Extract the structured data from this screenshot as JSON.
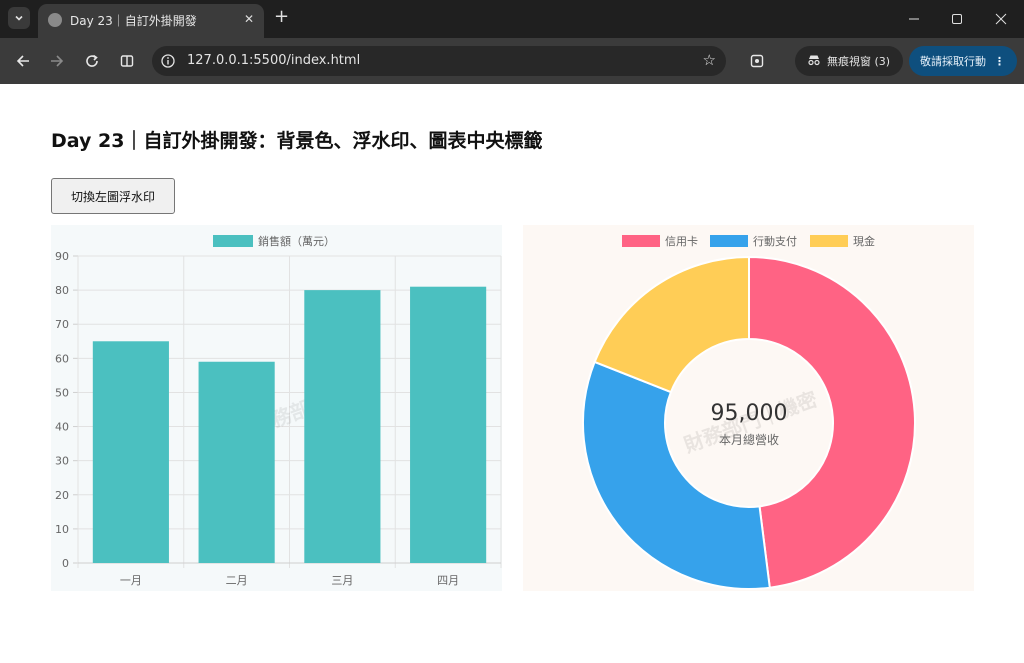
{
  "browser": {
    "tab_title": "Day 23｜自訂外掛開發",
    "tab_close": "✕",
    "new_tab": "+",
    "url": "127.0.0.1:5500/index.html",
    "incognito_label": "無痕視窗 (3)",
    "action_label": "敬請採取行動",
    "icons": [
      "tab-search-icon",
      "globe-icon",
      "close-icon",
      "plus-icon",
      "minimize-icon",
      "maximize-icon",
      "window-close-icon",
      "back-icon",
      "forward-icon",
      "reload-icon",
      "split-view-icon",
      "site-info-icon",
      "star-icon",
      "translate-icon",
      "incognito-icon",
      "more-icon"
    ]
  },
  "page": {
    "title": "Day 23｜自訂外掛開發：背景色、浮水印、圖表中央標籤",
    "toggle_button": "切換左圖浮水印"
  },
  "chart_data": [
    {
      "type": "bar",
      "categories": [
        "一月",
        "二月",
        "三月",
        "四月"
      ],
      "series": [
        {
          "name": "銷售額（萬元）",
          "values": [
            65,
            59,
            80,
            81
          ]
        }
      ],
      "ylim": [
        0,
        90
      ],
      "yticks": [
        0,
        10,
        20,
        30,
        40,
        50,
        60,
        70,
        80,
        90
      ],
      "grid": true,
      "legend": "top",
      "watermark": "業務部門",
      "background": "#f5f9fa",
      "colors": [
        "#4bc0c0"
      ]
    },
    {
      "type": "pie",
      "variant": "doughnut",
      "labels": [
        "信用卡",
        "行動支付",
        "現金"
      ],
      "values": [
        48,
        33,
        19
      ],
      "colors": [
        "#ff6384",
        "#36a2eb",
        "#ffcd56"
      ],
      "legend": "top",
      "center_value": "95,000",
      "center_label": "本月總營收",
      "watermark": "財務部門｜機密",
      "background": "#fdf8f4"
    }
  ]
}
